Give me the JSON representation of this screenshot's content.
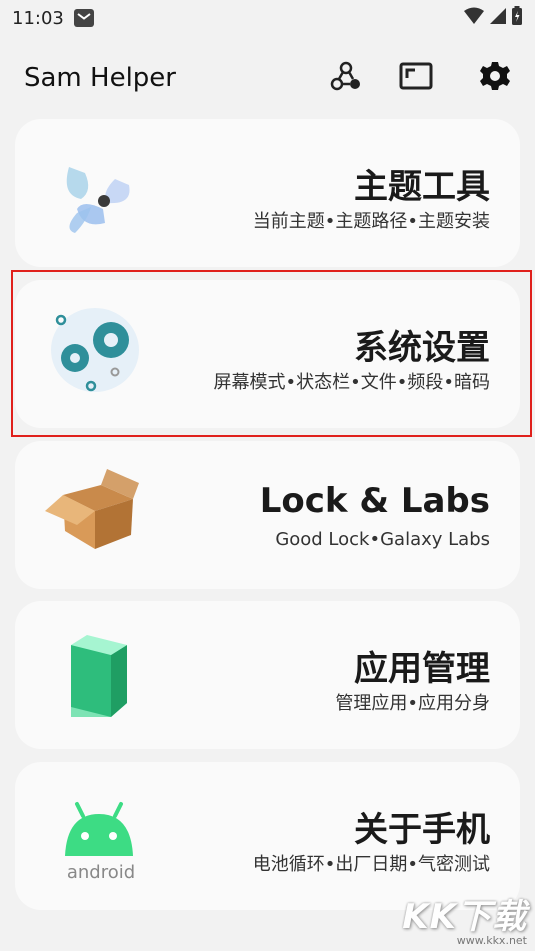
{
  "status_bar": {
    "time": "11:03",
    "icons": [
      "mail-icon",
      "wifi-icon",
      "signal-icon",
      "battery-charging-icon"
    ]
  },
  "app_bar": {
    "title": "Sam Helper",
    "actions": [
      "network-nodes-icon",
      "screen-frame-icon",
      "settings-gear-icon"
    ]
  },
  "cards": [
    {
      "title": "主题工具",
      "subtitle": "当前主题•主题路径•主题安装",
      "icon": "pinwheel-icon"
    },
    {
      "title": "系统设置",
      "subtitle": "屏幕模式•状态栏•文件•频段•暗码",
      "icon": "gears-icon",
      "highlighted": true
    },
    {
      "title": "Lock & Labs",
      "subtitle": "Good Lock•Galaxy Labs",
      "icon": "open-box-icon"
    },
    {
      "title": "应用管理",
      "subtitle": "管理应用•应用分身",
      "icon": "cube-icon"
    },
    {
      "title": "关于手机",
      "subtitle": "电池循环•出厂日期•气密测试",
      "icon": "android-icon",
      "icon_text": "android"
    }
  ],
  "watermark": {
    "logo": "KK下载",
    "url": "www.kkx.net"
  },
  "colors": {
    "highlight": "#e0201c",
    "card_bg": "#fafafa",
    "page_bg": "#f2f2f2",
    "android_green": "#3ddc84",
    "gear_teal": "#2f8f9a"
  }
}
